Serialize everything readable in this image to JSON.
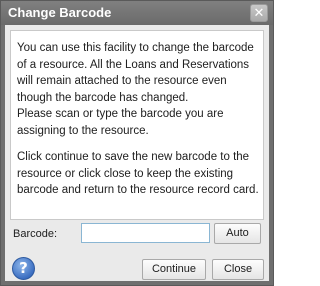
{
  "dialog": {
    "title": "Change Barcode",
    "close_glyph": "✕",
    "messages": [
      "You can use this facility to change the barcode of a resource. All the Loans and Reservations will remain attached to the resource even though the barcode has changed.",
      "Please scan or type the barcode you are assigning to the resource.",
      "Click continue to save the new barcode to the resource or click close to keep the existing barcode and return to the resource record card."
    ],
    "barcode_label": "Barcode:",
    "barcode_value": "",
    "auto_label": "Auto",
    "help_glyph": "?",
    "help_icon": "help-icon",
    "continue_label": "Continue",
    "close_label": "Close"
  }
}
